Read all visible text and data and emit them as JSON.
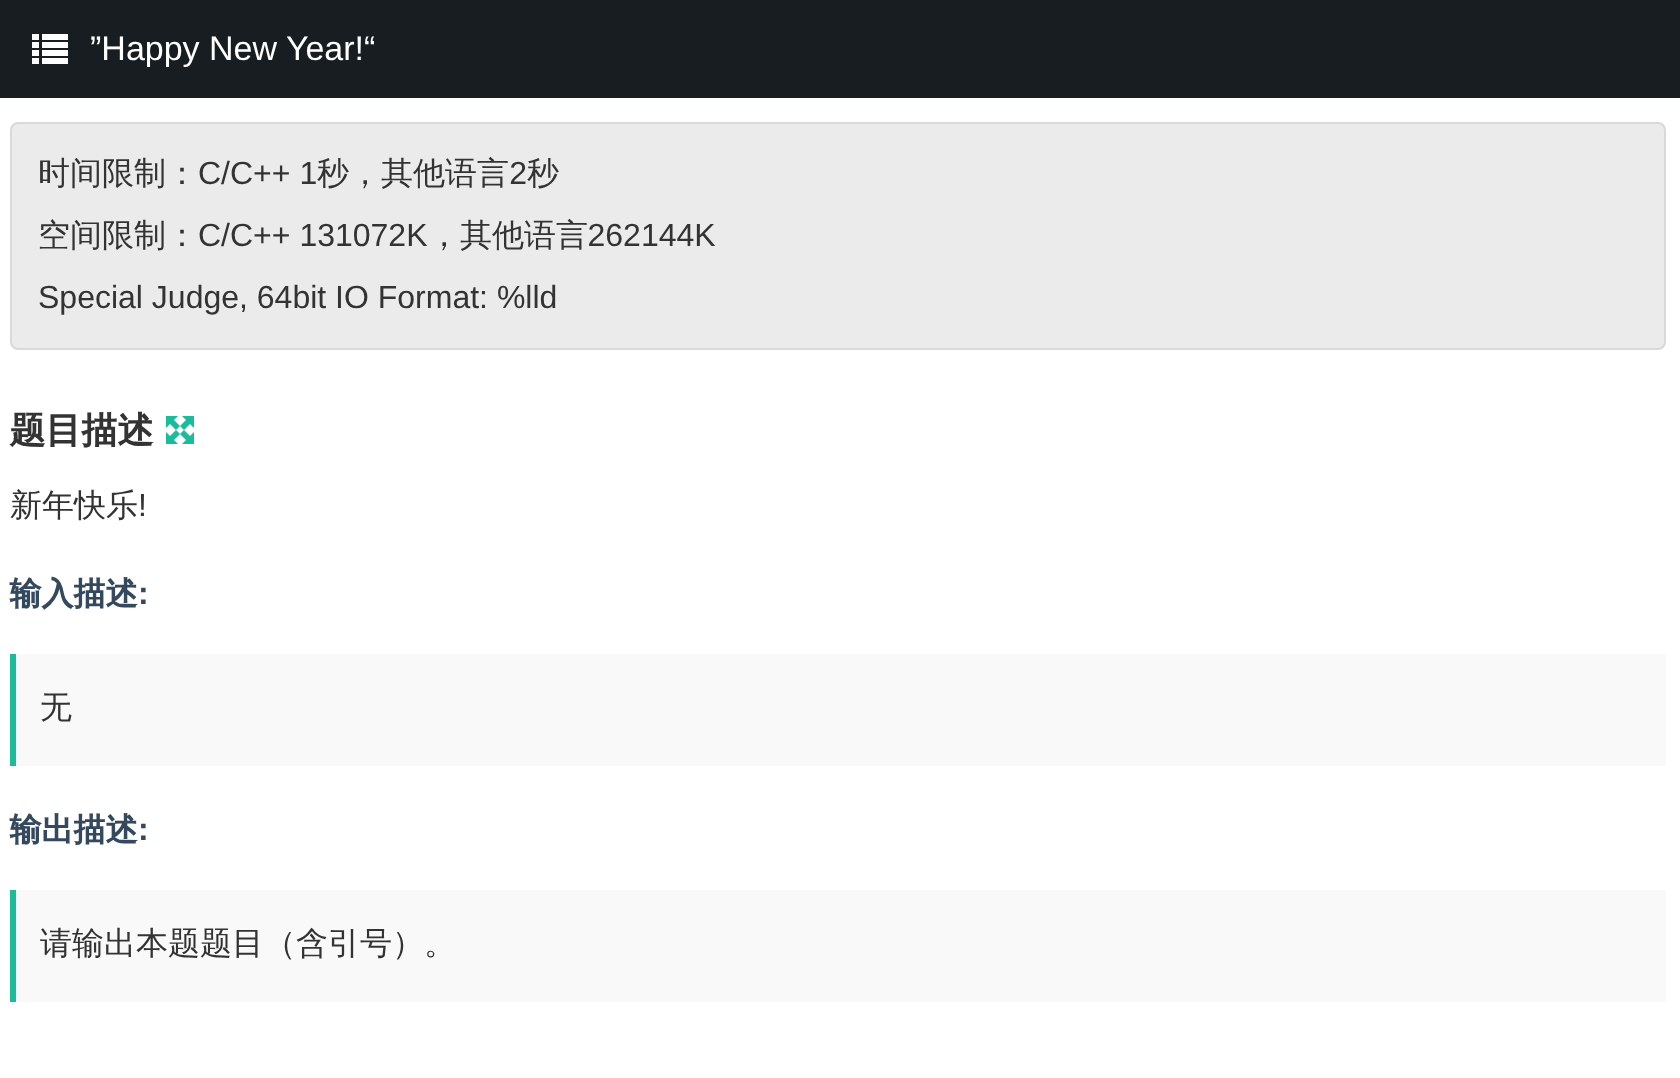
{
  "header": {
    "title": "”Happy New Year!“"
  },
  "limits": [
    "时间限制：C/C++ 1秒，其他语言2秒",
    "空间限制：C/C++ 131072K，其他语言262144K",
    "Special Judge, 64bit IO Format: %lld"
  ],
  "sections": [
    {
      "kind": "heading",
      "text": "题目描述"
    },
    {
      "kind": "paragraph",
      "text": "新年快乐!"
    },
    {
      "kind": "subheading",
      "text": "输入描述:"
    },
    {
      "kind": "quote",
      "text": "无"
    },
    {
      "kind": "subheading",
      "text": "输出描述:"
    },
    {
      "kind": "quote",
      "text": "请输出本题题目（含引号）。"
    }
  ]
}
